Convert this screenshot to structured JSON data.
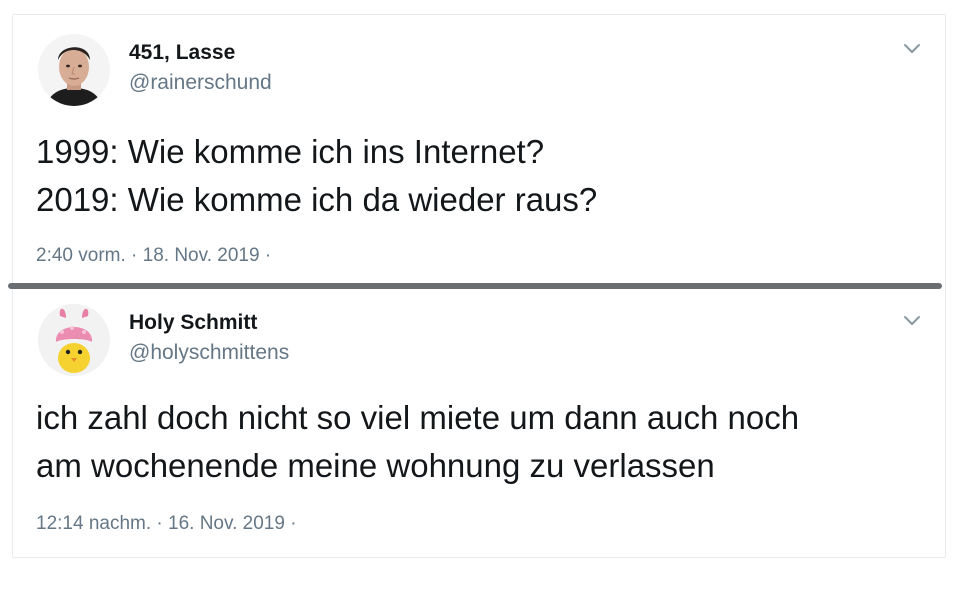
{
  "tweets": [
    {
      "display_name": "451, Lasse",
      "handle": "@rainerschund",
      "avatar_icon": "profile-photo-man",
      "text_lines": [
        "1999: Wie komme ich ins Internet?",
        "2019: Wie komme ich da wieder raus?"
      ],
      "timestamp": "2:40 vorm. · 18. Nov. 2019 ·",
      "menu_icon": "chevron-down-icon"
    },
    {
      "display_name": "Holy Schmitt",
      "handle": "@holyschmittens",
      "avatar_icon": "chick-with-pink-bunny-hat",
      "text_lines": [
        "ich zahl doch nicht so viel miete um dann auch noch",
        "am wochenende meine wohnung zu verlassen"
      ],
      "timestamp": "12:14 nachm. · 16. Nov. 2019 ·",
      "menu_icon": "chevron-down-icon"
    }
  ],
  "colors": {
    "text": "#14171a",
    "secondary": "#657786",
    "separator": "#6b6e70"
  }
}
